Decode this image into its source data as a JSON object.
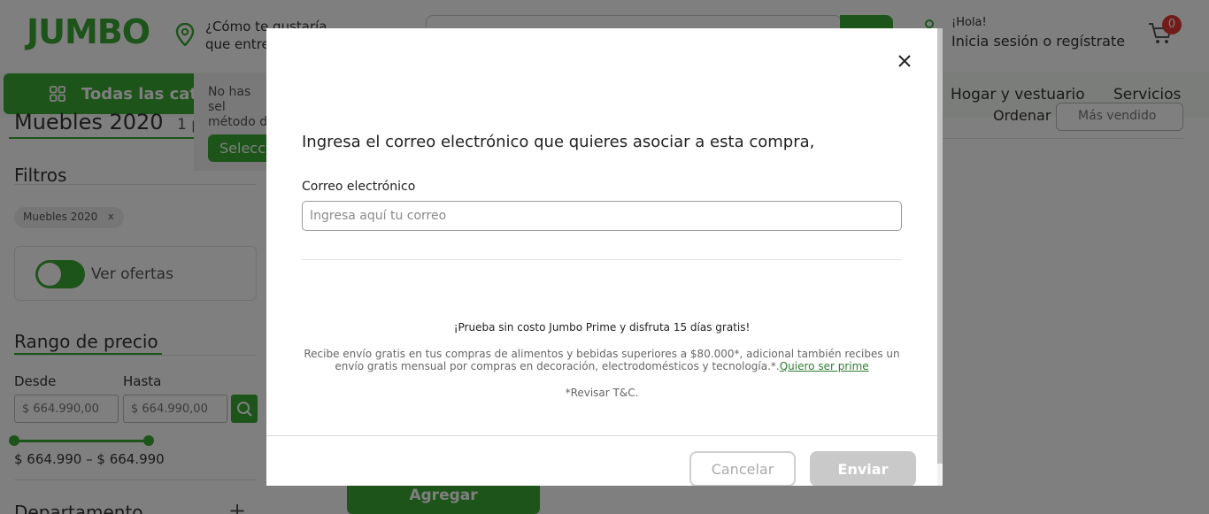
{
  "header": {
    "logo": "JUMBO",
    "location_text": "¿Cómo te gustaría que entre",
    "greeting": "¡Hola!",
    "login_text": "Inicia sesión o regístrate",
    "cart_count": "0"
  },
  "nav": {
    "all_categories": "Todas las categ",
    "items": [
      "Hogar y vestuario",
      "Servicios"
    ],
    "tooltip_text": "No has sel método d",
    "tooltip_button": "Selecc"
  },
  "content": {
    "page_title": "Muebles 2020",
    "result_count": "1 p",
    "sort_label": "Ordenar",
    "sort_value": "Más vendido",
    "add_button": "Agregar"
  },
  "filters": {
    "title": "Filtros",
    "active_chip": "Muebles 2020",
    "chip_remove": "x",
    "offers_label": "Ver ofertas",
    "price_range_title": "Rango de precio",
    "from_label": "Desde",
    "to_label": "Hasta",
    "from_value": "$ 664.990,00",
    "to_value": "$ 664.990,00",
    "range_text": "$ 664.990 – $ 664.990",
    "department_title": "Departamento",
    "department_toggle": "+"
  },
  "modal": {
    "title": "Ingresa el correo electrónico que quieres asociar a esta compra,",
    "email_label": "Correo electrónico",
    "email_placeholder": "Ingresa aquí tu correo",
    "email_value": "",
    "prime_title": "¡Prueba sin costo Jumbo Prime y disfruta 15 días gratis!",
    "prime_body": "Recibe envío gratis en tus compras de alimentos y bebidas superiores a $80.000*, adicional también recibes un envío gratis mensual por compras en decoración, electrodomésticos y tecnología.*.",
    "prime_link": "Quiero ser prime",
    "terms": "*Revisar T&C.",
    "cancel_label": "Cancelar",
    "send_label": "Enviar"
  },
  "colors": {
    "brand_green": "#3aa935",
    "link_green": "#2e7d32",
    "badge_red": "#e53935",
    "disabled_button": "#c9c9c9"
  }
}
